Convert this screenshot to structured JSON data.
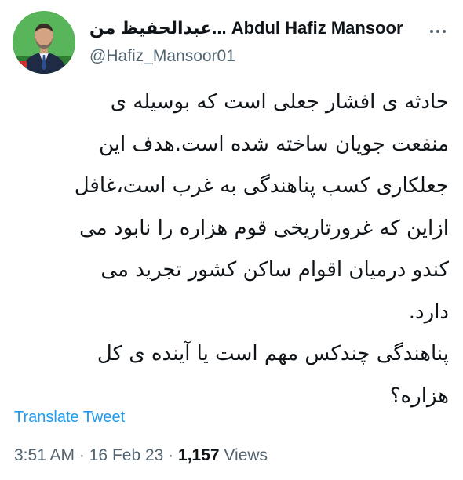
{
  "author": {
    "display_name": "عبدالحفیظ من... Abdul Hafiz Mansoor",
    "handle": "@Hafiz_Mansoor01",
    "avatar_icon": "profile-photo"
  },
  "tweet": {
    "text": "حادثه ی افشار جعلی است که بوسیله ی\nمنفعت جویان ساخته شده است.هدف این\nجعلکاری کسب پناهندگی به غرب است،غافل\nازاین که غرورتاریخی قوم هزاره را نابود می\nکندو درمیان اقوام ساکن کشور تجرید می\nدارد.\nپناهندگی چندکس مهم است یا آینده ی کل\nهزاره؟",
    "translate_label": "Translate Tweet"
  },
  "meta": {
    "time": "3:51 AM",
    "separator": "·",
    "date": "16 Feb 23",
    "views_count": "1,157",
    "views_label": "Views"
  },
  "colors": {
    "link": "#1d9bf0",
    "secondary_text": "#536471",
    "primary_text": "#0f1419"
  },
  "icons": {
    "more": "more-dots-icon"
  }
}
